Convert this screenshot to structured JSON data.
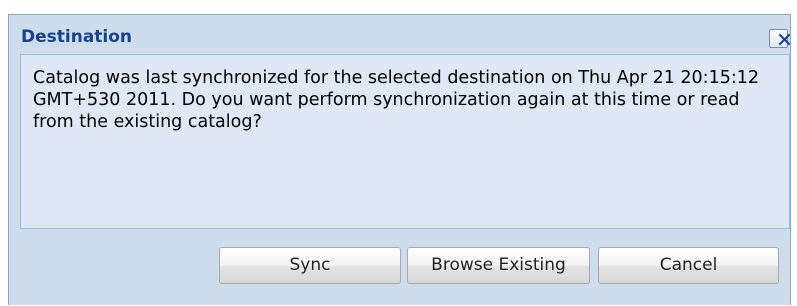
{
  "dialog": {
    "title": "Destination",
    "message": "Catalog was last synchronized for the selected destination on Thu Apr 21 20:15:12 GMT+530 2011. Do you want perform synchronization again at this time or read from the existing catalog?",
    "close_icon": "close-icon",
    "buttons": {
      "sync": "Sync",
      "browse_existing": "Browse Existing",
      "cancel": "Cancel"
    }
  },
  "colors": {
    "title_text": "#15428b",
    "frame_bg": "#cfdcec",
    "body_bg": "#dfe8f6",
    "border": "#99bbe8"
  }
}
